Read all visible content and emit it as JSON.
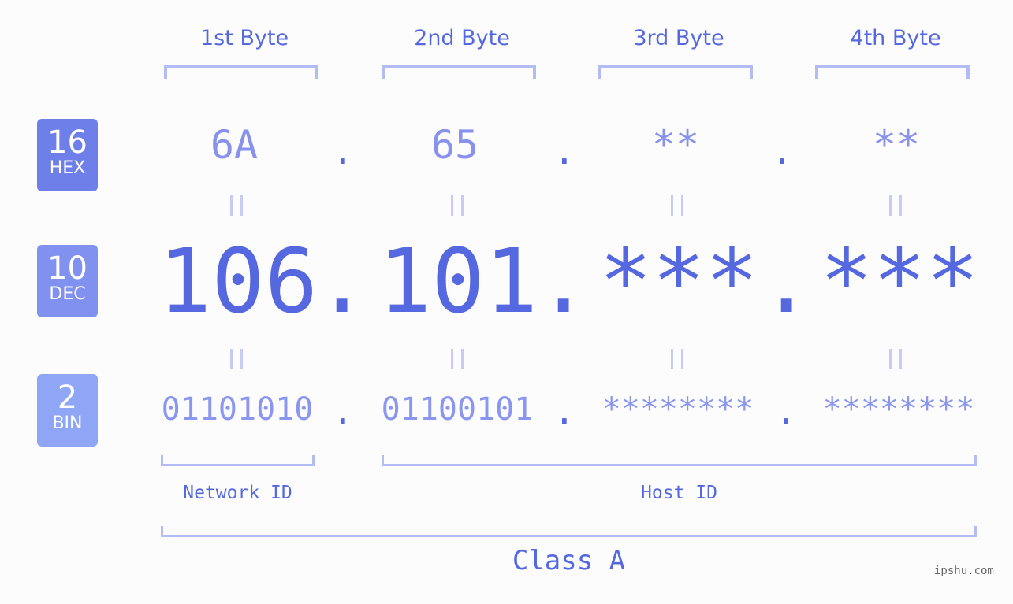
{
  "bytes": [
    {
      "label": "1st Byte",
      "hex": "6A",
      "dec": "106",
      "bin": "01101010"
    },
    {
      "label": "2nd Byte",
      "hex": "65",
      "dec": "101",
      "bin": "01100101"
    },
    {
      "label": "3rd Byte",
      "hex": "**",
      "dec": "***",
      "bin": "********"
    },
    {
      "label": "4th Byte",
      "hex": "**",
      "dec": "***",
      "bin": "********"
    }
  ],
  "badges": [
    {
      "num": "16",
      "name": "HEX",
      "color": "#6f7fea"
    },
    {
      "num": "10",
      "name": "DEC",
      "color": "#8191f0"
    },
    {
      "num": "2",
      "name": "BIN",
      "color": "#8fa6f6"
    }
  ],
  "separator": ".",
  "labels": {
    "network_id": "Network ID",
    "host_id": "Host ID",
    "class": "Class A"
  },
  "watermark": "ipshu.com"
}
